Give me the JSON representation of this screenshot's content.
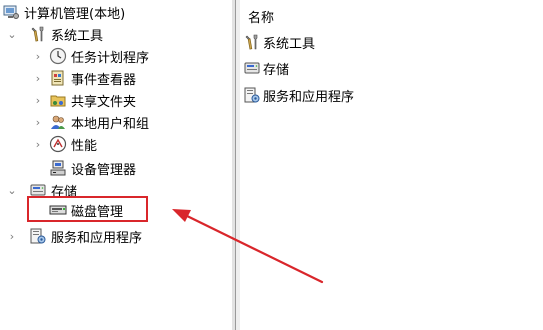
{
  "tree": {
    "root": {
      "label": "计算机管理(本地)",
      "icon": "computer-management-icon"
    },
    "system_tools": {
      "label": "系统工具",
      "icon": "tools-icon",
      "children": [
        {
          "label": "任务计划程序",
          "icon": "clock-icon"
        },
        {
          "label": "事件查看器",
          "icon": "event-viewer-icon"
        },
        {
          "label": "共享文件夹",
          "icon": "shared-folder-icon"
        },
        {
          "label": "本地用户和组",
          "icon": "users-icon"
        },
        {
          "label": "性能",
          "icon": "performance-icon"
        },
        {
          "label": "设备管理器",
          "icon": "device-manager-icon"
        }
      ]
    },
    "storage": {
      "label": "存储",
      "icon": "storage-icon",
      "children": [
        {
          "label": "磁盘管理",
          "icon": "disk-management-icon"
        }
      ]
    },
    "services": {
      "label": "服务和应用程序",
      "icon": "services-icon"
    }
  },
  "list": {
    "column_header": "名称",
    "items": [
      {
        "label": "系统工具",
        "icon": "tools-icon"
      },
      {
        "label": "存储",
        "icon": "storage-icon"
      },
      {
        "label": "服务和应用程序",
        "icon": "services-icon"
      }
    ]
  },
  "annotation": {
    "box_color": "#d9262b",
    "arrow_color": "#d9262b"
  }
}
